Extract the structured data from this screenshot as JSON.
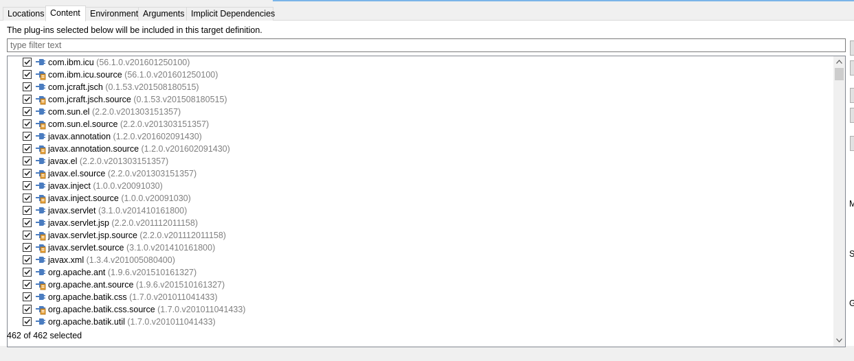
{
  "tabs": [
    {
      "label": "Locations"
    },
    {
      "label": "Content"
    },
    {
      "label": "Environment"
    },
    {
      "label": "Arguments"
    },
    {
      "label": "Implicit Dependencies"
    }
  ],
  "content": {
    "description": "The plug-ins selected below will be included in this target definition.",
    "filter_placeholder": "type filter text",
    "status": "462 of 462 selected",
    "plugins": [
      {
        "name": "com.ibm.icu",
        "version": "(56.1.0.v201601250100)",
        "checked": true,
        "source": false
      },
      {
        "name": "com.ibm.icu.source",
        "version": "(56.1.0.v201601250100)",
        "checked": true,
        "source": true
      },
      {
        "name": "com.jcraft.jsch",
        "version": "(0.1.53.v201508180515)",
        "checked": true,
        "source": false
      },
      {
        "name": "com.jcraft.jsch.source",
        "version": "(0.1.53.v201508180515)",
        "checked": true,
        "source": true
      },
      {
        "name": "com.sun.el",
        "version": "(2.2.0.v201303151357)",
        "checked": true,
        "source": false
      },
      {
        "name": "com.sun.el.source",
        "version": "(2.2.0.v201303151357)",
        "checked": true,
        "source": true
      },
      {
        "name": "javax.annotation",
        "version": "(1.2.0.v201602091430)",
        "checked": true,
        "source": false
      },
      {
        "name": "javax.annotation.source",
        "version": "(1.2.0.v201602091430)",
        "checked": true,
        "source": true
      },
      {
        "name": "javax.el",
        "version": "(2.2.0.v201303151357)",
        "checked": true,
        "source": false
      },
      {
        "name": "javax.el.source",
        "version": "(2.2.0.v201303151357)",
        "checked": true,
        "source": true
      },
      {
        "name": "javax.inject",
        "version": "(1.0.0.v20091030)",
        "checked": true,
        "source": false
      },
      {
        "name": "javax.inject.source",
        "version": "(1.0.0.v20091030)",
        "checked": true,
        "source": true
      },
      {
        "name": "javax.servlet",
        "version": "(3.1.0.v201410161800)",
        "checked": true,
        "source": false
      },
      {
        "name": "javax.servlet.jsp",
        "version": "(2.2.0.v201112011158)",
        "checked": true,
        "source": false
      },
      {
        "name": "javax.servlet.jsp.source",
        "version": "(2.2.0.v201112011158)",
        "checked": true,
        "source": true
      },
      {
        "name": "javax.servlet.source",
        "version": "(3.1.0.v201410161800)",
        "checked": true,
        "source": true
      },
      {
        "name": "javax.xml",
        "version": "(1.3.4.v201005080400)",
        "checked": true,
        "source": false
      },
      {
        "name": "org.apache.ant",
        "version": "(1.9.6.v201510161327)",
        "checked": true,
        "source": false
      },
      {
        "name": "org.apache.ant.source",
        "version": "(1.9.6.v201510161327)",
        "checked": true,
        "source": true
      },
      {
        "name": "org.apache.batik.css",
        "version": "(1.7.0.v201011041433)",
        "checked": true,
        "source": false
      },
      {
        "name": "org.apache.batik.css.source",
        "version": "(1.7.0.v201011041433)",
        "checked": true,
        "source": true
      },
      {
        "name": "org.apache.batik.util",
        "version": "(1.7.0.v201011041433)",
        "checked": true,
        "source": false
      }
    ]
  },
  "right_edge_letters": [
    "M",
    "S",
    "G"
  ],
  "colors": {
    "version_text": "#808080",
    "tab_accent": "#7ab4e8",
    "plugin_icon": "#4a7cc0",
    "source_badge": "#e8a33d"
  }
}
